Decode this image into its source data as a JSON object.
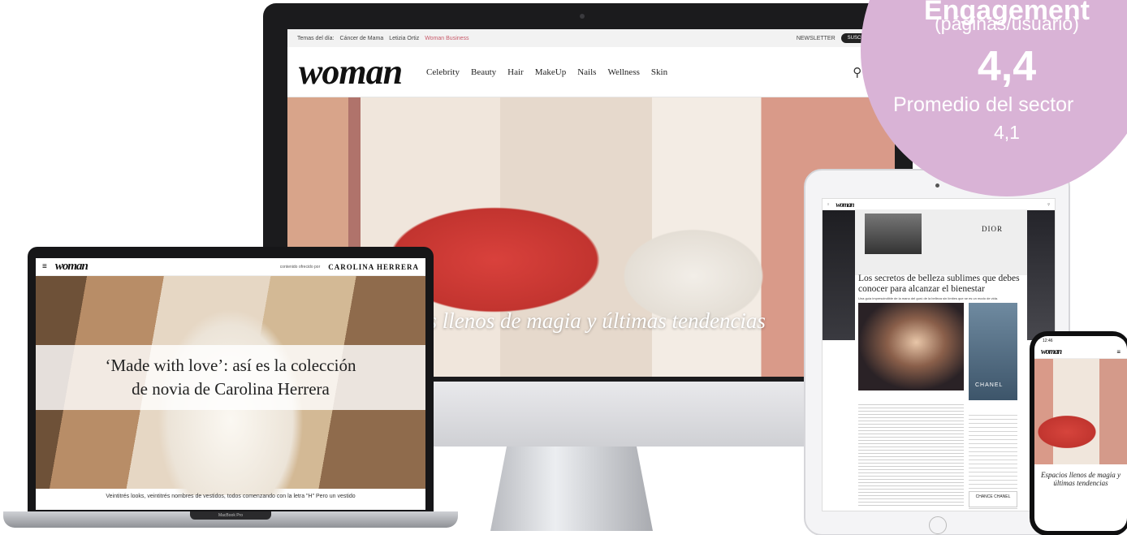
{
  "badge": {
    "title": "Engagement",
    "subtitle": "(páginas/usuario)",
    "value": "4,4",
    "benchmark_label": "Promedio del sector",
    "benchmark_value": "4,1",
    "color": "#d9b3d6"
  },
  "desktop": {
    "topbar": {
      "trending_label": "Temas del día:",
      "trending": [
        "Cáncer de Mama",
        "Letizia Ortiz",
        "Woman Business"
      ],
      "newsletter": "NEWSLETTER",
      "subscribe": "SUSCRÍBETE"
    },
    "logo": "woman",
    "nav": [
      "Celebrity",
      "Beauty",
      "Hair",
      "MakeUp",
      "Nails",
      "Wellness",
      "Skin"
    ],
    "hero_caption": "os llenos de magia y últimas tendencias"
  },
  "laptop": {
    "logo": "woman",
    "sponsor_label": "contenido ofrecido por",
    "sponsor_brand": "CAROLINA HERRERA",
    "headline_line1": "‘Made with love’: así es la colección",
    "headline_line2": "de novia de Carolina Herrera",
    "paragraph": "Veintitrés looks, veintitrés nombres de vestidos, todos comenzando con la letra \"H\" Pero un vestido",
    "device_label": "MacBook Pro"
  },
  "tablet": {
    "logo": "woman",
    "ad_brand": "DIOR",
    "headline": "Los secretos de belleza sublimes que debes conocer para alcanzar el bienestar",
    "subhead": "Una guía imprescindible de la mano del gurú de la belleza sin límites que se es un modo de vida.",
    "image_brand": "CHANEL",
    "ad_box": "CHANCE CHANEL"
  },
  "phone": {
    "time": "12:46",
    "logo": "woman",
    "caption": "Espacios llenos de magia y últimas tendencias"
  }
}
